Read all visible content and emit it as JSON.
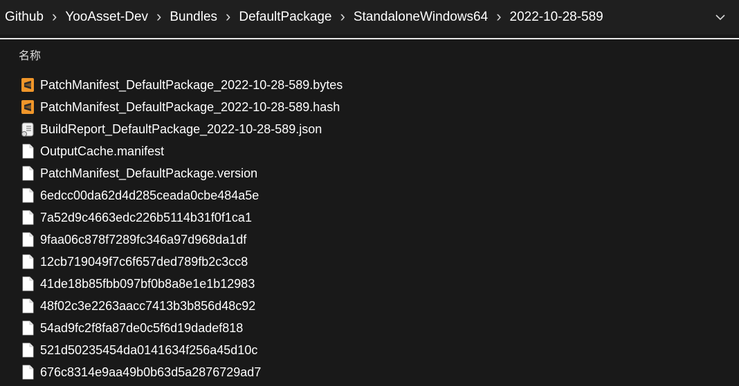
{
  "breadcrumb": [
    "Github",
    "YooAsset-Dev",
    "Bundles",
    "DefaultPackage",
    "StandaloneWindows64",
    "2022-10-28-589"
  ],
  "column_header": "名称",
  "files": [
    {
      "name": "PatchManifest_DefaultPackage_2022-10-28-589.bytes",
      "icon": "sublime"
    },
    {
      "name": "PatchManifest_DefaultPackage_2022-10-28-589.hash",
      "icon": "sublime"
    },
    {
      "name": "BuildReport_DefaultPackage_2022-10-28-589.json",
      "icon": "script"
    },
    {
      "name": "OutputCache.manifest",
      "icon": "blank"
    },
    {
      "name": "PatchManifest_DefaultPackage.version",
      "icon": "blank"
    },
    {
      "name": "6edcc00da62d4d285ceada0cbe484a5e",
      "icon": "blank"
    },
    {
      "name": "7a52d9c4663edc226b5114b31f0f1ca1",
      "icon": "blank"
    },
    {
      "name": "9faa06c878f7289fc346a97d968da1df",
      "icon": "blank"
    },
    {
      "name": "12cb719049f7c6f657ded789fb2c3cc8",
      "icon": "blank"
    },
    {
      "name": "41de18b85fbb097bf0b8a8e1e1b12983",
      "icon": "blank"
    },
    {
      "name": "48f02c3e2263aacc7413b3b856d48c92",
      "icon": "blank"
    },
    {
      "name": "54ad9fc2f8fa87de0c5f6d19dadef818",
      "icon": "blank"
    },
    {
      "name": "521d50235454da0141634f256a45d10c",
      "icon": "blank"
    },
    {
      "name": "676c8314e9aa49b0b63d5a2876729ad7",
      "icon": "blank"
    }
  ],
  "colors": {
    "sublime_orange": "#f0962a",
    "background": "#191919",
    "address_bar": "#1f1f1f"
  }
}
